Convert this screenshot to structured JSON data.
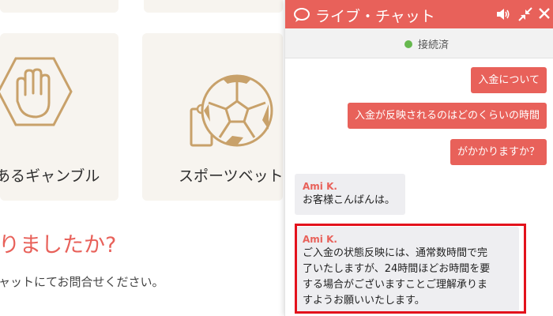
{
  "background": {
    "categories": [
      {
        "label": "あるギャンブル",
        "icon": "hand-stop-hexagon-icon"
      },
      {
        "label": "スポーツベット",
        "icon": "soccer-ball-ticket-icon"
      }
    ],
    "faq": {
      "title": "りましたか?",
      "subtitle": "ャットにてお問合せください。"
    }
  },
  "chat": {
    "title": "ライブ・チャット",
    "status": "接続済",
    "header_icons": [
      "speech-bubble-icon",
      "sound-icon",
      "minimize-icon",
      "close-icon"
    ],
    "messages_out": [
      "入金について",
      "入金が反映されるのはどのくらいの時間",
      "がかかりますか？"
    ],
    "messages_in": [
      {
        "sender": "Ami K.",
        "lines": [
          "お客様こんばんは。"
        ]
      },
      {
        "sender": "Ami K.",
        "lines": [
          "ご入金の状態反映には、通常数時間で完",
          "了いたしますが、24時間ほどお時間を要",
          "する場合がございますことご理解承りま",
          "すようお願いいたします。"
        ]
      }
    ]
  },
  "colors": {
    "accent": "#e8615a",
    "icon_gold": "#c8a16a",
    "status_green": "#66b84e",
    "highlight_red": "#e3121c",
    "incoming_bubble": "#eeeef1"
  }
}
